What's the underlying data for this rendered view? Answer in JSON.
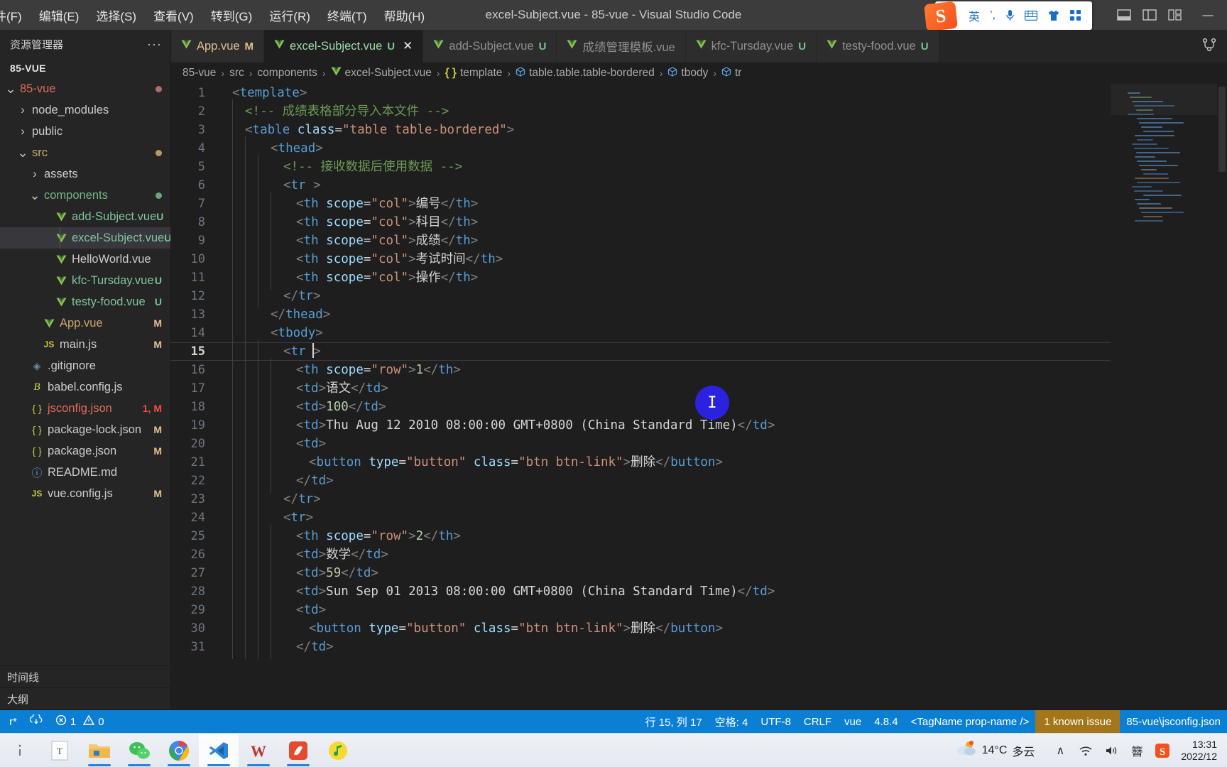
{
  "window": {
    "title": "excel-Subject.vue - 85-vue - Visual Studio Code",
    "minimize": "—"
  },
  "menubar": {
    "items": [
      {
        "label": "件(F)"
      },
      {
        "label": "编辑(E)"
      },
      {
        "label": "选择(S)"
      },
      {
        "label": "查看(V)"
      },
      {
        "label": "转到(G)"
      },
      {
        "label": "运行(R)"
      },
      {
        "label": "终端(T)"
      },
      {
        "label": "帮助(H)"
      }
    ]
  },
  "ime": {
    "logo": "S",
    "items": [
      "英",
      "’,",
      "mic-icon",
      "keyboard-icon",
      "skin-icon",
      "apps-icon"
    ]
  },
  "sidebar": {
    "title": "资源管理器",
    "more": "···",
    "root_label": "85-VUE",
    "tree": [
      {
        "label": "85-vue",
        "indent": 0,
        "arrow": "∨",
        "icon": "",
        "badge": "",
        "dot": "#b06a6a",
        "color": "c-red"
      },
      {
        "label": "node_modules",
        "indent": 1,
        "arrow": "›",
        "icon": "",
        "badge": "",
        "dot": "",
        "color": "c-plain"
      },
      {
        "label": "public",
        "indent": 1,
        "arrow": "›",
        "icon": "",
        "badge": "",
        "dot": "",
        "color": "c-plain"
      },
      {
        "label": "src",
        "indent": 1,
        "arrow": "∨",
        "icon": "",
        "badge": "",
        "dot": "#b99a62",
        "color": "c-gold"
      },
      {
        "label": "assets",
        "indent": 2,
        "arrow": "›",
        "icon": "",
        "badge": "",
        "dot": "",
        "color": "c-plain"
      },
      {
        "label": "components",
        "indent": 2,
        "arrow": "∨",
        "icon": "",
        "badge": "",
        "dot": "#67a878",
        "color": "c-green"
      },
      {
        "label": "add-Subject.vue",
        "indent": 3,
        "arrow": "",
        "icon": "vue",
        "badge": "U",
        "badge_class": "badge-U",
        "color": "c-vue"
      },
      {
        "label": "excel-Subject.vue",
        "indent": 3,
        "arrow": "",
        "icon": "vue",
        "badge": "U",
        "badge_class": "badge-U",
        "color": "c-vue",
        "selected": true
      },
      {
        "label": "HelloWorld.vue",
        "indent": 3,
        "arrow": "",
        "icon": "vue",
        "badge": "",
        "color": "c-plain"
      },
      {
        "label": "kfc-Tursday.vue",
        "indent": 3,
        "arrow": "",
        "icon": "vue",
        "badge": "U",
        "badge_class": "badge-U",
        "color": "c-vue"
      },
      {
        "label": "testy-food.vue",
        "indent": 3,
        "arrow": "",
        "icon": "vue",
        "badge": "U",
        "badge_class": "badge-U",
        "color": "c-vue"
      },
      {
        "label": "App.vue",
        "indent": 2,
        "arrow": "",
        "icon": "vue",
        "badge": "M",
        "badge_class": "badge-M",
        "color": "c-gold"
      },
      {
        "label": "main.js",
        "indent": 2,
        "arrow": "",
        "icon": "js",
        "badge": "M",
        "badge_class": "badge-M",
        "color": "c-plain"
      },
      {
        "label": ".gitignore",
        "indent": 1,
        "arrow": "",
        "icon": "git",
        "badge": "",
        "color": "c-plain"
      },
      {
        "label": "babel.config.js",
        "indent": 1,
        "arrow": "",
        "icon": "babel",
        "badge": "",
        "color": "c-plain"
      },
      {
        "label": "jsconfig.json",
        "indent": 1,
        "arrow": "",
        "icon": "json",
        "badge": "1, M",
        "badge_class": "badge-err",
        "color": "c-red"
      },
      {
        "label": "package-lock.json",
        "indent": 1,
        "arrow": "",
        "icon": "json",
        "badge": "M",
        "badge_class": "badge-M",
        "color": "c-plain"
      },
      {
        "label": "package.json",
        "indent": 1,
        "arrow": "",
        "icon": "json",
        "badge": "M",
        "badge_class": "badge-M",
        "color": "c-plain"
      },
      {
        "label": "README.md",
        "indent": 1,
        "arrow": "",
        "icon": "md",
        "badge": "",
        "color": "c-plain"
      },
      {
        "label": "vue.config.js",
        "indent": 1,
        "arrow": "",
        "icon": "js",
        "badge": "M",
        "badge_class": "badge-M",
        "color": "c-plain"
      }
    ],
    "sections": [
      {
        "label": "时间线"
      },
      {
        "label": "大纲"
      }
    ]
  },
  "tabs": [
    {
      "name": "App.vue",
      "status": "M",
      "status_class": "M",
      "active": false,
      "modified": true
    },
    {
      "name": "excel-Subject.vue",
      "status": "U",
      "status_class": "U",
      "active": true,
      "close": "✕"
    },
    {
      "name": "add-Subject.vue",
      "status": "U",
      "status_class": "U",
      "active": false
    },
    {
      "name": "成绩管理模板.vue",
      "status": "",
      "status_class": "",
      "active": false
    },
    {
      "name": "kfc-Tursday.vue",
      "status": "U",
      "status_class": "U",
      "active": false
    },
    {
      "name": "testy-food.vue",
      "status": "U",
      "status_class": "U",
      "active": false
    }
  ],
  "breadcrumb": [
    {
      "label": "85-vue",
      "icon": ""
    },
    {
      "label": "src",
      "icon": ""
    },
    {
      "label": "components",
      "icon": ""
    },
    {
      "label": "excel-Subject.vue",
      "icon": "vue"
    },
    {
      "label": "template",
      "icon": "braces"
    },
    {
      "label": "table.table.table-bordered",
      "icon": "cube"
    },
    {
      "label": "tbody",
      "icon": "cube"
    },
    {
      "label": "tr",
      "icon": "cube"
    }
  ],
  "editor": {
    "active_line": 15,
    "lines": [
      {
        "n": 1,
        "indent": 0,
        "guides": 0
      },
      {
        "n": 2,
        "indent": 1,
        "guides": 1
      },
      {
        "n": 3,
        "indent": 1,
        "guides": 1
      },
      {
        "n": 4,
        "indent": 3,
        "guides": 2
      },
      {
        "n": 5,
        "indent": 4,
        "guides": 3
      },
      {
        "n": 6,
        "indent": 4,
        "guides": 3
      },
      {
        "n": 7,
        "indent": 5,
        "guides": 4
      },
      {
        "n": 8,
        "indent": 5,
        "guides": 4
      },
      {
        "n": 9,
        "indent": 5,
        "guides": 4
      },
      {
        "n": 10,
        "indent": 5,
        "guides": 4
      },
      {
        "n": 11,
        "indent": 5,
        "guides": 4
      },
      {
        "n": 12,
        "indent": 4,
        "guides": 3
      },
      {
        "n": 13,
        "indent": 3,
        "guides": 2
      },
      {
        "n": 14,
        "indent": 3,
        "guides": 2
      },
      {
        "n": 15,
        "indent": 4,
        "guides": 3
      },
      {
        "n": 16,
        "indent": 5,
        "guides": 4
      },
      {
        "n": 17,
        "indent": 5,
        "guides": 4
      },
      {
        "n": 18,
        "indent": 5,
        "guides": 4
      },
      {
        "n": 19,
        "indent": 5,
        "guides": 4
      },
      {
        "n": 20,
        "indent": 5,
        "guides": 4
      },
      {
        "n": 21,
        "indent": 6,
        "guides": 4
      },
      {
        "n": 22,
        "indent": 5,
        "guides": 4
      },
      {
        "n": 23,
        "indent": 4,
        "guides": 3
      },
      {
        "n": 24,
        "indent": 4,
        "guides": 3
      },
      {
        "n": 25,
        "indent": 5,
        "guides": 4
      },
      {
        "n": 26,
        "indent": 5,
        "guides": 4
      },
      {
        "n": 27,
        "indent": 5,
        "guides": 4
      },
      {
        "n": 28,
        "indent": 5,
        "guides": 4
      },
      {
        "n": 29,
        "indent": 5,
        "guides": 4
      },
      {
        "n": 30,
        "indent": 6,
        "guides": 4
      },
      {
        "n": 31,
        "indent": 5,
        "guides": 4
      }
    ],
    "code_text": {
      "l1": "<template>",
      "l2": "<!-- 成绩表格部分导入本文件 -->",
      "l3_tag": "table",
      "l3_attr": "class",
      "l3_val": "\"table table-bordered\"",
      "l4": "thead",
      "l5": "<!-- 接收数据后使用数据 -->",
      "l6": "tr",
      "l7_text": "编号",
      "l8_text": "科目",
      "l9_text": "成绩",
      "l10_text": "考试时间",
      "l11_text": "操作",
      "scope_attr": "scope",
      "scope_col": "\"col\"",
      "scope_row": "\"row\"",
      "l16_text": "1",
      "l17_text": "语文",
      "l18_text": "100",
      "l19_text": "Thu Aug 12 2010 08:00:00 GMT+0800 (China Standard Time)",
      "btn_tag": "button",
      "btn_type_attr": "type",
      "btn_type_val": "\"button\"",
      "btn_class_attr": "class",
      "btn_class_val": "\"btn btn-link\"",
      "btn_text": "删除",
      "l25_text": "2",
      "l26_text": "数学",
      "l27_text": "59",
      "l28_text": "Sun Sep 01 2013 08:00:00 GMT+0800 (China Standard Time)"
    }
  },
  "statusbar": {
    "left": [
      {
        "label": "r*",
        "icon": ""
      },
      {
        "label": "",
        "icon": "sync-icon"
      },
      {
        "label": "1",
        "icon": "error-icon"
      },
      {
        "label": "0",
        "icon": "warning-icon"
      }
    ],
    "right": [
      {
        "label": "行 15, 列 17"
      },
      {
        "label": "空格: 4"
      },
      {
        "label": "UTF-8"
      },
      {
        "label": "CRLF"
      },
      {
        "label": "vue"
      },
      {
        "label": "4.8.4"
      },
      {
        "label": "<TagName prop-name />"
      },
      {
        "label": "1 known issue",
        "highlight": true
      },
      {
        "label": "85-vue\\jsconfig.json"
      }
    ]
  },
  "taskbar": {
    "apps": [
      {
        "name": "text-editor-icon",
        "glyph": "T"
      },
      {
        "name": "file-explorer-icon",
        "glyph": ""
      },
      {
        "name": "wechat-icon",
        "glyph": ""
      },
      {
        "name": "chrome-icon",
        "glyph": ""
      },
      {
        "name": "vscode-icon",
        "glyph": "",
        "active": true
      },
      {
        "name": "wps-icon",
        "glyph": "W"
      },
      {
        "name": "xmind-icon",
        "glyph": ""
      },
      {
        "name": "qqmusic-icon",
        "glyph": ""
      }
    ],
    "weather": {
      "temp": "14°C",
      "condition": "多云"
    },
    "tray": [
      "∧",
      "wifi-icon",
      "volume-icon",
      "簪",
      "sogou-icon"
    ],
    "clock": {
      "time": "13:31",
      "date": "2022/12"
    }
  }
}
